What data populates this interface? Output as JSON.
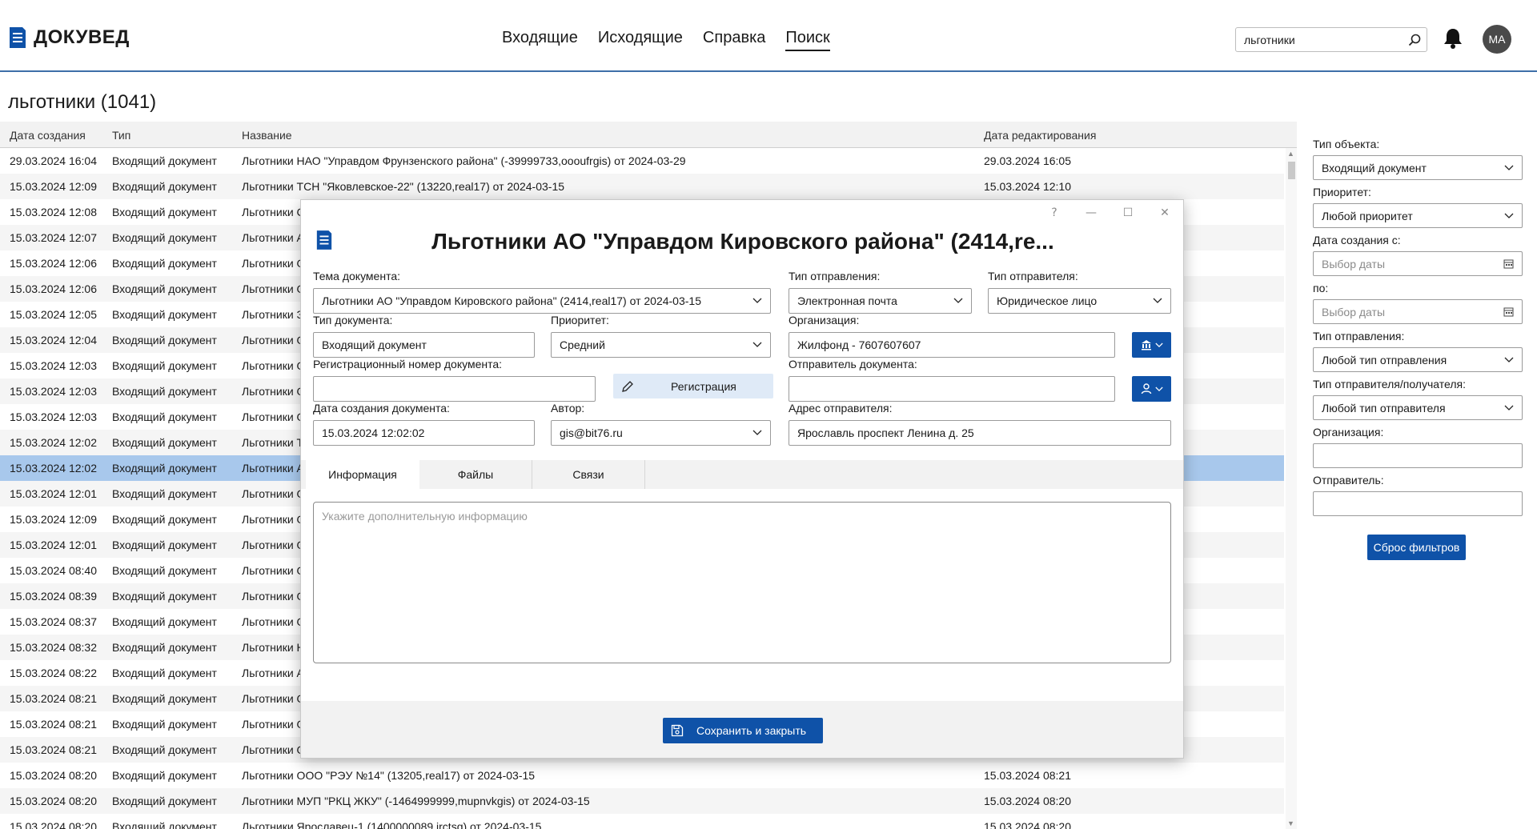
{
  "window_controls": [
    "?",
    "—",
    "❐",
    "✕"
  ],
  "header": {
    "logo_text": "ДОКУВЕД",
    "nav": [
      {
        "label": "Входящие",
        "active": false
      },
      {
        "label": "Исходящие",
        "active": false
      },
      {
        "label": "Справка",
        "active": false
      },
      {
        "label": "Поиск",
        "active": true
      }
    ],
    "search_value": "льготники",
    "avatar_initials": "МА"
  },
  "main": {
    "title": "льготники (1041)",
    "columns": [
      "Дата создания",
      "Тип",
      "Название",
      "Дата редактирования"
    ],
    "rows": [
      {
        "created": "29.03.2024 16:04",
        "type": "Входящий документ",
        "name": "Льготники НАО \"Управдом Фрунзенского района\" (-39999733,oooufrgis)  от 2024-03-29",
        "edited": "29.03.2024 16:05"
      },
      {
        "created": "15.03.2024 12:09",
        "type": "Входящий документ",
        "name": "Льготники ТСН \"Яковлевское-22\" (13220,real17)  от 2024-03-15",
        "edited": "15.03.2024 12:10"
      },
      {
        "created": "15.03.2024 12:08",
        "type": "Входящий документ",
        "name": "Льготники С",
        "edited": ""
      },
      {
        "created": "15.03.2024 12:07",
        "type": "Входящий документ",
        "name": "Льготники А",
        "edited": ""
      },
      {
        "created": "15.03.2024 12:06",
        "type": "Входящий документ",
        "name": "Льготники О",
        "edited": ""
      },
      {
        "created": "15.03.2024 12:06",
        "type": "Входящий документ",
        "name": "Льготники О",
        "edited": ""
      },
      {
        "created": "15.03.2024 12:05",
        "type": "Входящий документ",
        "name": "Льготники З",
        "edited": ""
      },
      {
        "created": "15.03.2024 12:04",
        "type": "Входящий документ",
        "name": "Льготники О",
        "edited": ""
      },
      {
        "created": "15.03.2024 12:03",
        "type": "Входящий документ",
        "name": "Льготники О",
        "edited": ""
      },
      {
        "created": "15.03.2024 12:03",
        "type": "Входящий документ",
        "name": "Льготники О",
        "edited": ""
      },
      {
        "created": "15.03.2024 12:03",
        "type": "Входящий документ",
        "name": "Льготники О",
        "edited": ""
      },
      {
        "created": "15.03.2024 12:02",
        "type": "Входящий документ",
        "name": "Льготники Т",
        "edited": ""
      },
      {
        "created": "15.03.2024 12:02",
        "type": "Входящий документ",
        "name": "Льготники А",
        "edited": "",
        "selected": true
      },
      {
        "created": "15.03.2024 12:01",
        "type": "Входящий документ",
        "name": "Льготники О",
        "edited": ""
      },
      {
        "created": "15.03.2024 12:09",
        "type": "Входящий документ",
        "name": "Льготники О",
        "edited": ""
      },
      {
        "created": "15.03.2024 12:01",
        "type": "Входящий документ",
        "name": "Льготники О",
        "edited": ""
      },
      {
        "created": "15.03.2024 08:40",
        "type": "Входящий документ",
        "name": "Льготники О",
        "edited": ""
      },
      {
        "created": "15.03.2024 08:39",
        "type": "Входящий документ",
        "name": "Льготники О",
        "edited": ""
      },
      {
        "created": "15.03.2024 08:37",
        "type": "Входящий документ",
        "name": "Льготники О",
        "edited": ""
      },
      {
        "created": "15.03.2024 08:32",
        "type": "Входящий документ",
        "name": "Льготники Н",
        "edited": ""
      },
      {
        "created": "15.03.2024 08:22",
        "type": "Входящий документ",
        "name": "Льготники А",
        "edited": ""
      },
      {
        "created": "15.03.2024 08:21",
        "type": "Входящий документ",
        "name": "Льготники О",
        "edited": ""
      },
      {
        "created": "15.03.2024 08:21",
        "type": "Входящий документ",
        "name": "Льготники О",
        "edited": ""
      },
      {
        "created": "15.03.2024 08:21",
        "type": "Входящий документ",
        "name": "Льготники О",
        "edited": ""
      },
      {
        "created": "15.03.2024 08:20",
        "type": "Входящий документ",
        "name": "Льготники ООО \"РЭУ №14\" (13205,real17)  от 2024-03-15",
        "edited": "15.03.2024 08:21"
      },
      {
        "created": "15.03.2024 08:20",
        "type": "Входящий документ",
        "name": "Льготники МУП \"РКЦ ЖКУ\" (-1464999999,mupnvkgis)  от 2024-03-15",
        "edited": "15.03.2024 08:20"
      },
      {
        "created": "15.03.2024 08:20",
        "type": "Входящий документ",
        "name": "Льготники Ярославец-1 (1400000089,irctsq)  от 2024-03-15",
        "edited": "15.03.2024 08:20"
      }
    ]
  },
  "filters": {
    "object_type_label": "Тип объекта:",
    "object_type_value": "Входящий документ",
    "priority_label": "Приоритет:",
    "priority_value": "Любой приоритет",
    "created_from_label": "Дата создания с:",
    "created_from_placeholder": "Выбор даты",
    "to_label": "по:",
    "to_placeholder": "Выбор даты",
    "send_type_label": "Тип отправления:",
    "send_type_value": "Любой тип отправления",
    "sender_type_label": "Тип отправителя/получателя:",
    "sender_type_value": "Любой тип отправителя",
    "org_label": "Организация:",
    "org_value": "",
    "sender_label": "Отправитель:",
    "sender_value": "",
    "reset_label": "Сброс фильтров"
  },
  "modal": {
    "title": "Льготники АО \"Управдом Кировского района\" (2414,re...",
    "subject_label": "Тема документа:",
    "subject_value": "Льготники АО \"Управдом Кировского района\" (2414,real17)  от 2024-03-15",
    "send_type_label": "Тип отправления:",
    "send_type_value": "Электронная почта",
    "sender_type_label": "Тип отправителя:",
    "sender_type_value": "Юридическое лицо",
    "doc_type_label": "Тип документа:",
    "doc_type_value": "Входящий документ",
    "priority_label": "Приоритет:",
    "priority_value": "Средний",
    "org_label": "Организация:",
    "org_value": "Жилфонд - 7607607607",
    "reg_number_label": "Регистрационный номер документа:",
    "reg_number_value": "",
    "reg_button": "Регистрация",
    "doc_sender_label": "Отправитель документа:",
    "doc_sender_value": "",
    "created_label": "Дата создания документа:",
    "created_value": "15.03.2024 12:02:02",
    "author_label": "Автор:",
    "author_value": "gis@bit76.ru",
    "address_label": "Адрес отправителя:",
    "address_value": "Ярославль проспект Ленина д. 25",
    "tabs": [
      "Информация",
      "Файлы",
      "Связи"
    ],
    "info_placeholder": "Укажите дополнительную информацию",
    "save_button": "Сохранить и закрыть"
  },
  "colors": {
    "accent": "#0f52a8",
    "selected_row": "#a8c8ec",
    "header_rule": "#3d6fa8"
  }
}
